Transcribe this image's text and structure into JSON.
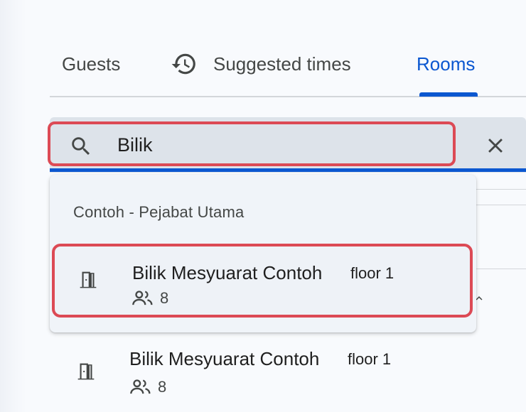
{
  "tabs": {
    "guests": "Guests",
    "suggested_times": "Suggested times",
    "rooms": "Rooms",
    "active": "Rooms"
  },
  "search": {
    "value": "Bilik",
    "icon": "search-icon",
    "clear_icon": "close-icon"
  },
  "dropdown": {
    "group_label": "Contoh - Pejabat Utama",
    "option": {
      "name": "Bilik Mesyuarat Contoh",
      "floor": "floor 1",
      "capacity": "8",
      "icon": "door-icon"
    }
  },
  "room_list": [
    {
      "name": "Bilik Mesyuarat Contoh",
      "floor": "floor 1",
      "capacity": "8",
      "icon": "door-icon"
    }
  ],
  "colors": {
    "accent": "#0b57d0",
    "highlight_border": "#dc4a55",
    "field_bg": "#dde3ea",
    "menu_bg": "#f0f4f9"
  }
}
